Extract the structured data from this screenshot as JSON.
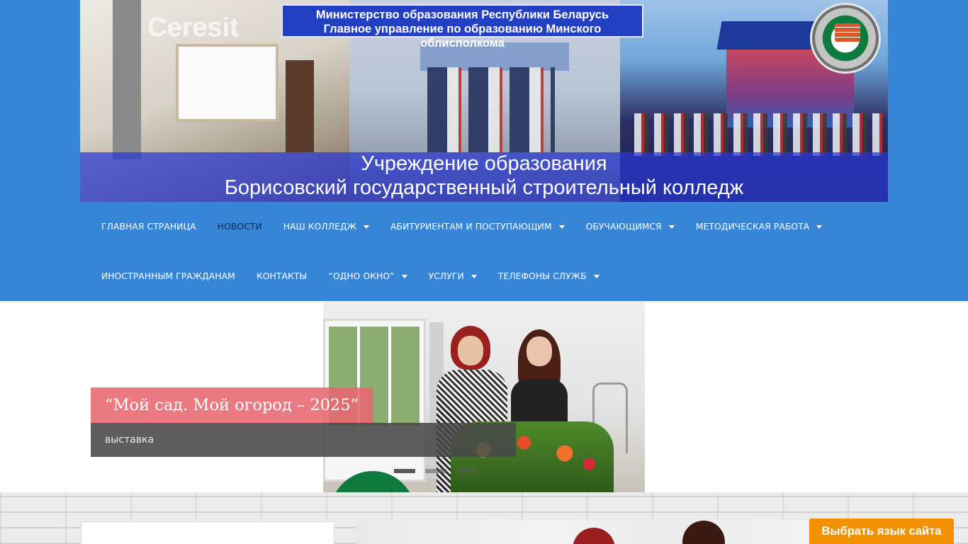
{
  "header": {
    "ministry_line1": "Министерство образования Республики Беларусь",
    "ministry_line2": "Главное управление по образованию Минского облисполкома",
    "ceresit_text": "Ceresit",
    "institution_line1": "Учреждение образования",
    "institution_line2": "Борисовский государственный строительный колледж"
  },
  "nav": {
    "row1": [
      {
        "label": "ГЛАВНАЯ СТРАНИЦА",
        "dropdown": false,
        "active": false
      },
      {
        "label": "НОВОСТИ",
        "dropdown": false,
        "active": true
      },
      {
        "label": "НАШ КОЛЛЕДЖ",
        "dropdown": true,
        "active": false
      },
      {
        "label": "АБИТУРИЕНТАМ И ПОСТУПАЮЩИМ",
        "dropdown": true,
        "active": false
      },
      {
        "label": "ОБУЧАЮЩИМСЯ",
        "dropdown": true,
        "active": false
      },
      {
        "label": "МЕТОДИЧЕСКАЯ РАБОТА",
        "dropdown": true,
        "active": false
      }
    ],
    "row2": [
      {
        "label": "ИНОСТРАННЫМ ГРАЖДАНАМ",
        "dropdown": false,
        "active": false
      },
      {
        "label": "КОНТАКТЫ",
        "dropdown": false,
        "active": false
      },
      {
        "label": "“ОДНО ОКНО”",
        "dropdown": true,
        "active": false
      },
      {
        "label": "УСЛУГИ",
        "dropdown": true,
        "active": false
      },
      {
        "label": "ТЕЛЕФОНЫ СЛУЖБ",
        "dropdown": true,
        "active": false
      }
    ]
  },
  "slider": {
    "title": "“Мой сад. Мой огород – 2025”",
    "caption": "выставка",
    "dot_count": 3,
    "active_dot": 0
  },
  "language_button": "Выбрать язык сайта",
  "colors": {
    "header_bg": "#3685d6",
    "nav_active": "#0d2a5a",
    "slide_title_bg": "#e86670",
    "slide_caption_bg": "#484848",
    "lang_button_bg": "#f29200"
  }
}
